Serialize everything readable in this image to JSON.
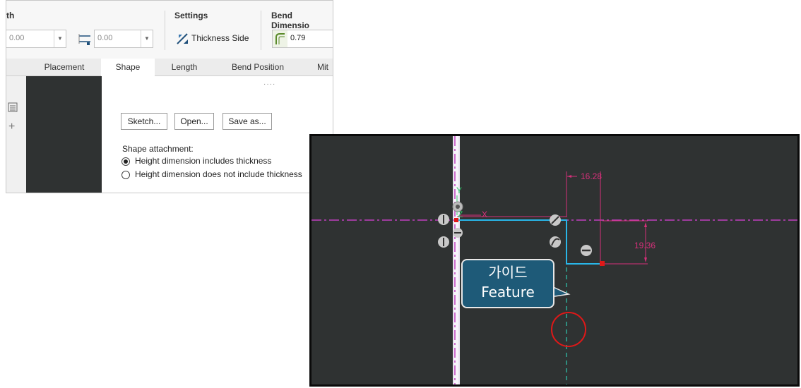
{
  "ribbon": {
    "length_group_title": "th",
    "settings_group_title": "Settings",
    "bend_group_title": "Bend Dimensio",
    "length_value": "0.00",
    "length_value2": "0.00",
    "thickness_side_label": "Thickness Side",
    "bend_value": "0.79"
  },
  "tabs": [
    {
      "label": "Placement"
    },
    {
      "label": "Shape"
    },
    {
      "label": "Length"
    },
    {
      "label": "Bend Position"
    },
    {
      "label": "Mit"
    }
  ],
  "shape_panel": {
    "sketch_label": "Sketch...",
    "open_label": "Open...",
    "save_as_label": "Save as...",
    "attachment_title": "Shape attachment:",
    "option1": "Height dimension includes thickness",
    "option2": "Height dimension does not include thickness",
    "selected_option": 1
  },
  "viewport": {
    "dim_horizontal": "16.28",
    "dim_vertical": "19.36",
    "axis_y": "Y",
    "axis_z": "Z",
    "axis_x": "X",
    "callout_line1": "가이드",
    "callout_line2": "Feature"
  },
  "colors": {
    "viewport_bg": "#2f3232",
    "sketch_line": "#29b6e8",
    "dimension": "#d6307a",
    "centerline": "#c040c0",
    "guide_line": "#30c8b0",
    "highlight_circle": "#e01818",
    "callout_bg": "#1e5a78"
  }
}
